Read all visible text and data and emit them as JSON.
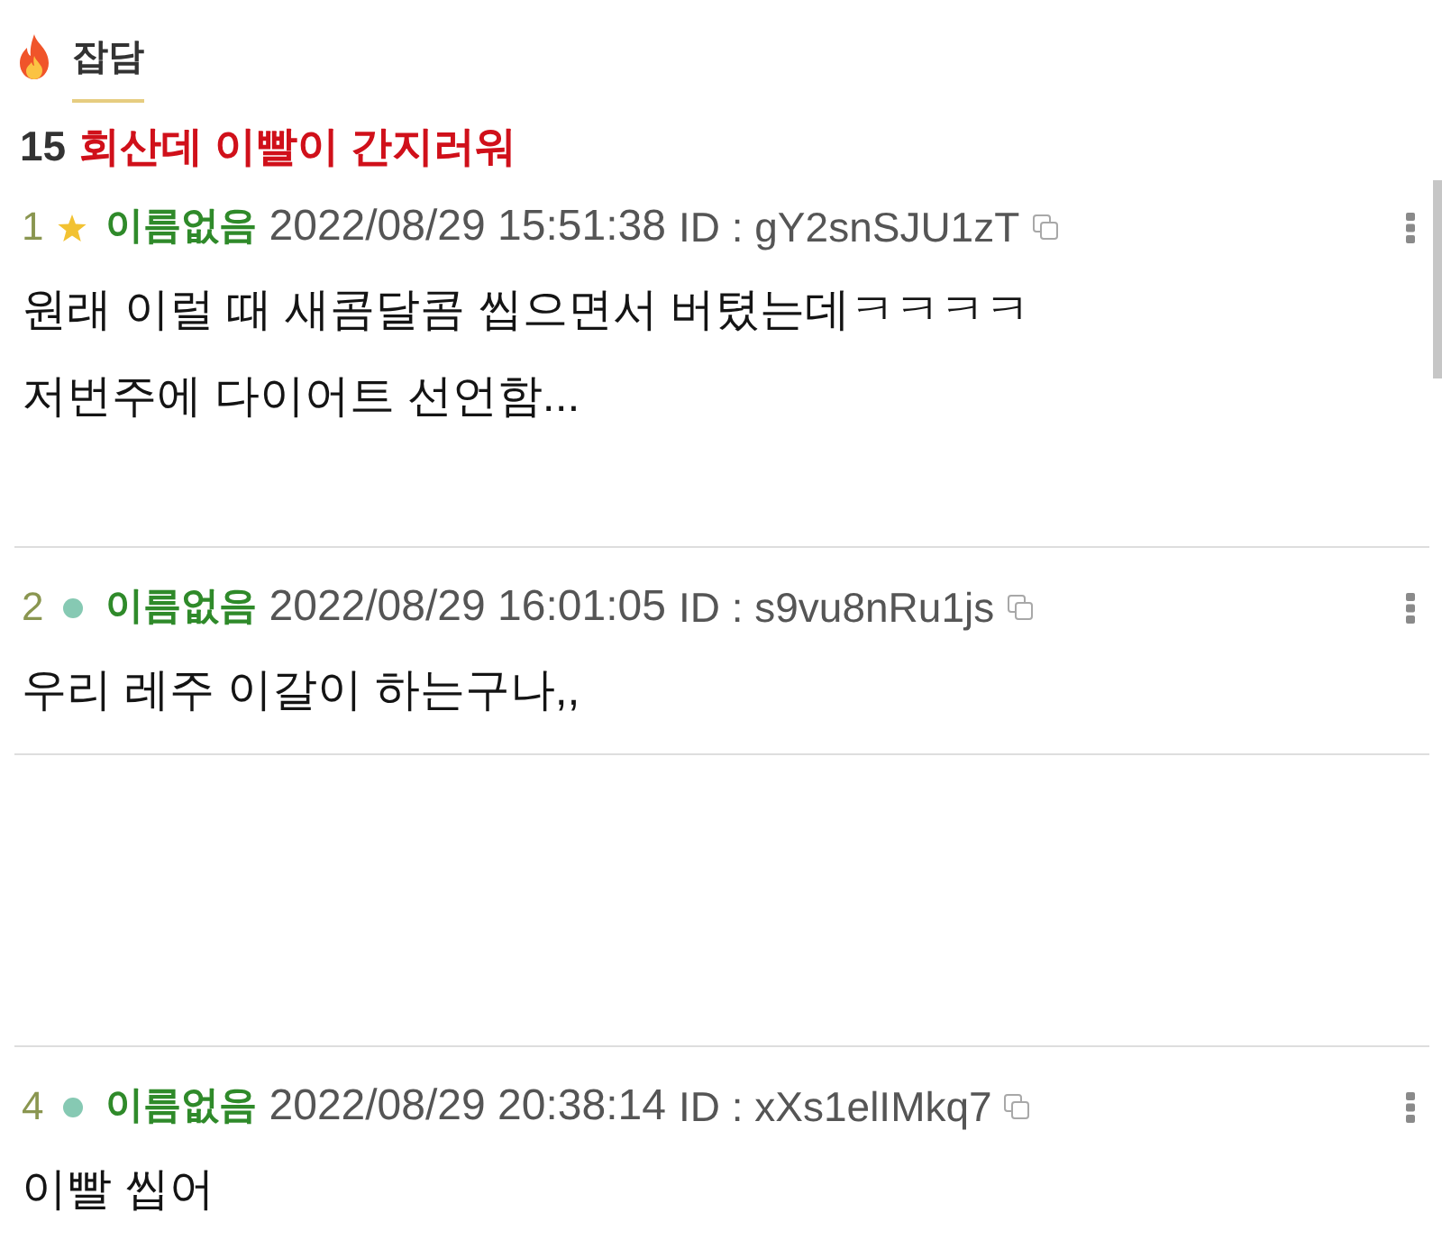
{
  "category": {
    "label": "잡담"
  },
  "thread": {
    "number": "15",
    "title": "회산데 이빨이 간지러워"
  },
  "posts": [
    {
      "number": "1",
      "kind": "star",
      "name": "이름없음",
      "datetime": "2022/08/29 15:51:38",
      "id": "ID : gY2snSJU1zT",
      "lines": [
        "원래 이럴 때 새콤달콤 씹으면서 버텼는데ㅋㅋㅋㅋ",
        "저번주에 다이어트 선언함..."
      ]
    },
    {
      "number": "2",
      "kind": "dot",
      "name": "이름없음",
      "datetime": "2022/08/29 16:01:05",
      "id": "ID : s9vu8nRu1js",
      "lines": [
        "우리 레주 이갈이 하는구나,,"
      ]
    },
    {
      "number": "4",
      "kind": "dot",
      "name": "이름없음",
      "datetime": "2022/08/29 20:38:14",
      "id": "ID : xXs1elIMkq7",
      "lines": [
        "이빨 씹어"
      ]
    }
  ]
}
